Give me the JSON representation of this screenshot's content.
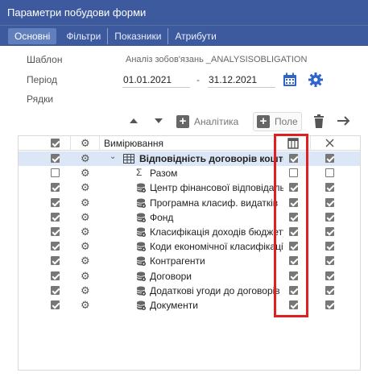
{
  "window": {
    "title": "Параметри побудови форми"
  },
  "tabs": [
    {
      "label": "Основні",
      "active": true
    },
    {
      "label": "Фільтри"
    },
    {
      "label": "Показники"
    },
    {
      "label": "Атрибути"
    }
  ],
  "form": {
    "template_label": "Шаблон",
    "template_value": "Аналіз зобов'язань _ANALYSISOBLIGATION",
    "period_label": "Період",
    "date_from": "01.01.2021",
    "date_to": "31.12.2021",
    "dash": "-",
    "rows_label": "Рядки"
  },
  "toolbar": {
    "analytics_label": "Аналітика",
    "field_label": "Поле"
  },
  "grid": {
    "header": {
      "dimensions_label": "Вимірювання"
    },
    "rows": [
      {
        "label": "Відповідність договорів кошторис",
        "bold": true,
        "c1": true,
        "c3": true,
        "c4": true,
        "icon": "table",
        "expander": true
      },
      {
        "label": "Разом",
        "c1": false,
        "c3": false,
        "c4": false,
        "icon": "sigma"
      },
      {
        "label": "Центр фінансової відповідальності",
        "c1": true,
        "c3": true,
        "c4": true,
        "icon": "db"
      },
      {
        "label": "Програмна класиф. видатків",
        "c1": true,
        "c3": true,
        "c4": true,
        "icon": "db"
      },
      {
        "label": "Фонд",
        "c1": true,
        "c3": true,
        "c4": true,
        "icon": "db"
      },
      {
        "label": "Класифікація доходів бюджету",
        "c1": true,
        "c3": true,
        "c4": true,
        "icon": "db"
      },
      {
        "label": "Коди економічної класифікації",
        "c1": true,
        "c3": true,
        "c4": true,
        "icon": "db"
      },
      {
        "label": "Контрагенти",
        "c1": true,
        "c3": true,
        "c4": true,
        "icon": "db"
      },
      {
        "label": "Договори",
        "c1": true,
        "c3": true,
        "c4": true,
        "icon": "db"
      },
      {
        "label": "Додаткові угоди до договорів",
        "c1": true,
        "c3": true,
        "c4": true,
        "icon": "db"
      },
      {
        "label": "Документи",
        "c1": true,
        "c3": true,
        "c4": true,
        "icon": "db"
      }
    ]
  },
  "colors": {
    "titlebar": "#3d5a9e",
    "accent_blue": "#2f64c8",
    "highlight_red": "#e02020",
    "selected_row": "#dbe6f7"
  }
}
